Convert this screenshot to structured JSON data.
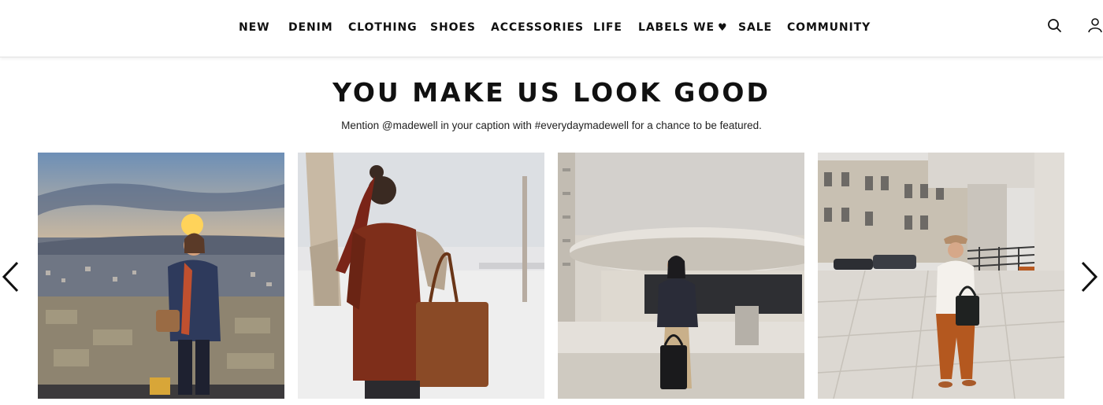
{
  "nav": {
    "items": [
      {
        "label": "NEW"
      },
      {
        "label": "DENIM"
      },
      {
        "label": "CLOTHING"
      },
      {
        "label": "SHOES"
      },
      {
        "label": "ACCESSORIES"
      },
      {
        "label": "LIFE"
      },
      {
        "label": "LABELS WE"
      },
      {
        "label": "SALE"
      },
      {
        "label": "COMMUNITY"
      }
    ],
    "heart_glyph": "♥",
    "search_icon": "search-icon",
    "account_icon": "account-icon"
  },
  "section": {
    "title": "YOU MAKE US LOOK GOOD",
    "subtitle": "Mention @madewell in your caption with #everydaymadewell for a chance to be featured."
  },
  "carousel": {
    "prev_icon": "chevron-left-icon",
    "next_icon": "chevron-right-icon",
    "tiles": [
      {
        "scene": "sunset-overlook",
        "accent": "#f0a040"
      },
      {
        "scene": "winter-back-view",
        "accent": "#9b3a22"
      },
      {
        "scene": "modern-building",
        "accent": "#d8cfc2"
      },
      {
        "scene": "city-plaza",
        "accent": "#b4581f"
      }
    ]
  },
  "colors": {
    "text": "#111111",
    "header_border": "#e2e2e2"
  }
}
